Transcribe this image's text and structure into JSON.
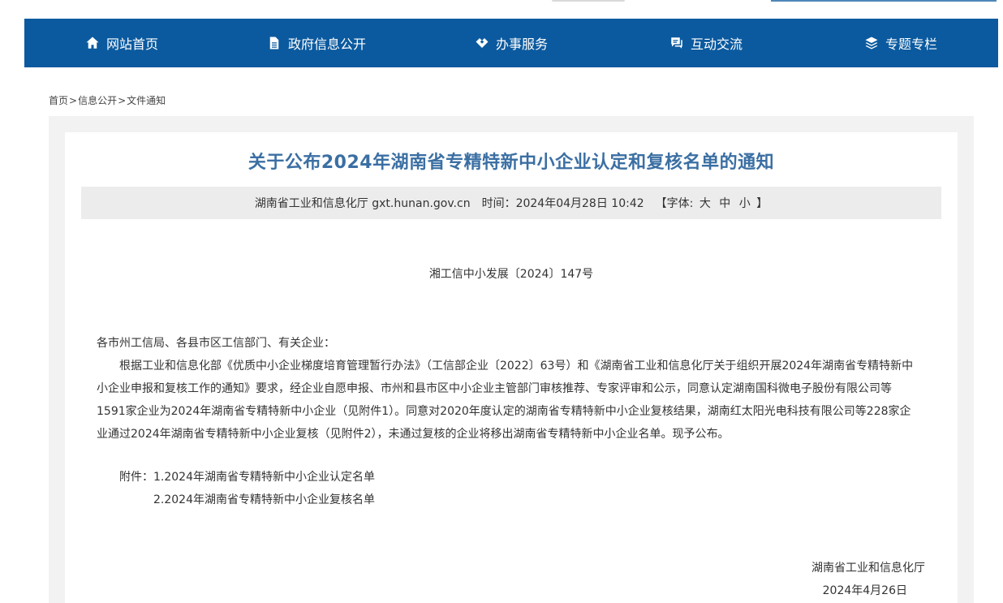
{
  "nav": {
    "items": [
      {
        "label": "网站首页",
        "icon": "home-icon"
      },
      {
        "label": "政府信息公开",
        "icon": "document-icon"
      },
      {
        "label": "办事服务",
        "icon": "handshake-icon"
      },
      {
        "label": "互动交流",
        "icon": "chat-icon"
      },
      {
        "label": "专题专栏",
        "icon": "layers-icon"
      }
    ]
  },
  "breadcrumb": {
    "items": [
      "首页",
      "信息公开",
      "文件通知"
    ],
    "separator": ">"
  },
  "article": {
    "title": "关于公布2024年湖南省专精特新中小企业认定和复核名单的通知",
    "meta": {
      "source": "湖南省工业和信息化厅 gxt.hunan.gov.cn",
      "time": "时间：2024年04月28日 10:42",
      "font_label_open": "【字体:",
      "font_large": "大",
      "font_medium": "中",
      "font_small": "小",
      "font_label_close": "】"
    },
    "doc_number": "湘工信中小发展〔2024〕147号",
    "salutation": "各市州工信局、各县市区工信部门、有关企业：",
    "paragraph": "根据工业和信息化部《优质中小企业梯度培育管理暂行办法》（工信部企业〔2022〕63号）和《湖南省工业和信息化厅关于组织开展2024年湖南省专精特新中小企业申报和复核工作的通知》要求，经企业自愿申报、市州和县市区中小企业主管部门审核推荐、专家评审和公示，同意认定湖南国科微电子股份有限公司等1591家企业为2024年湖南省专精特新中小企业（见附件1）。同意对2020年度认定的湖南省专精特新中小企业复核结果，湖南红太阳光电科技有限公司等228家企业通过2024年湖南省专精特新中小企业复核（见附件2），未通过复核的企业将移出湖南省专精特新中小企业名单。现予公布。",
    "attachments_label": "附件：",
    "attachments": [
      "1.2024年湖南省专精特新中小企业认定名单",
      "2.2024年湖南省专精特新中小企业复核名单"
    ],
    "signature_org": "湖南省工业和信息化厅",
    "signature_date": "2024年4月26日"
  }
}
